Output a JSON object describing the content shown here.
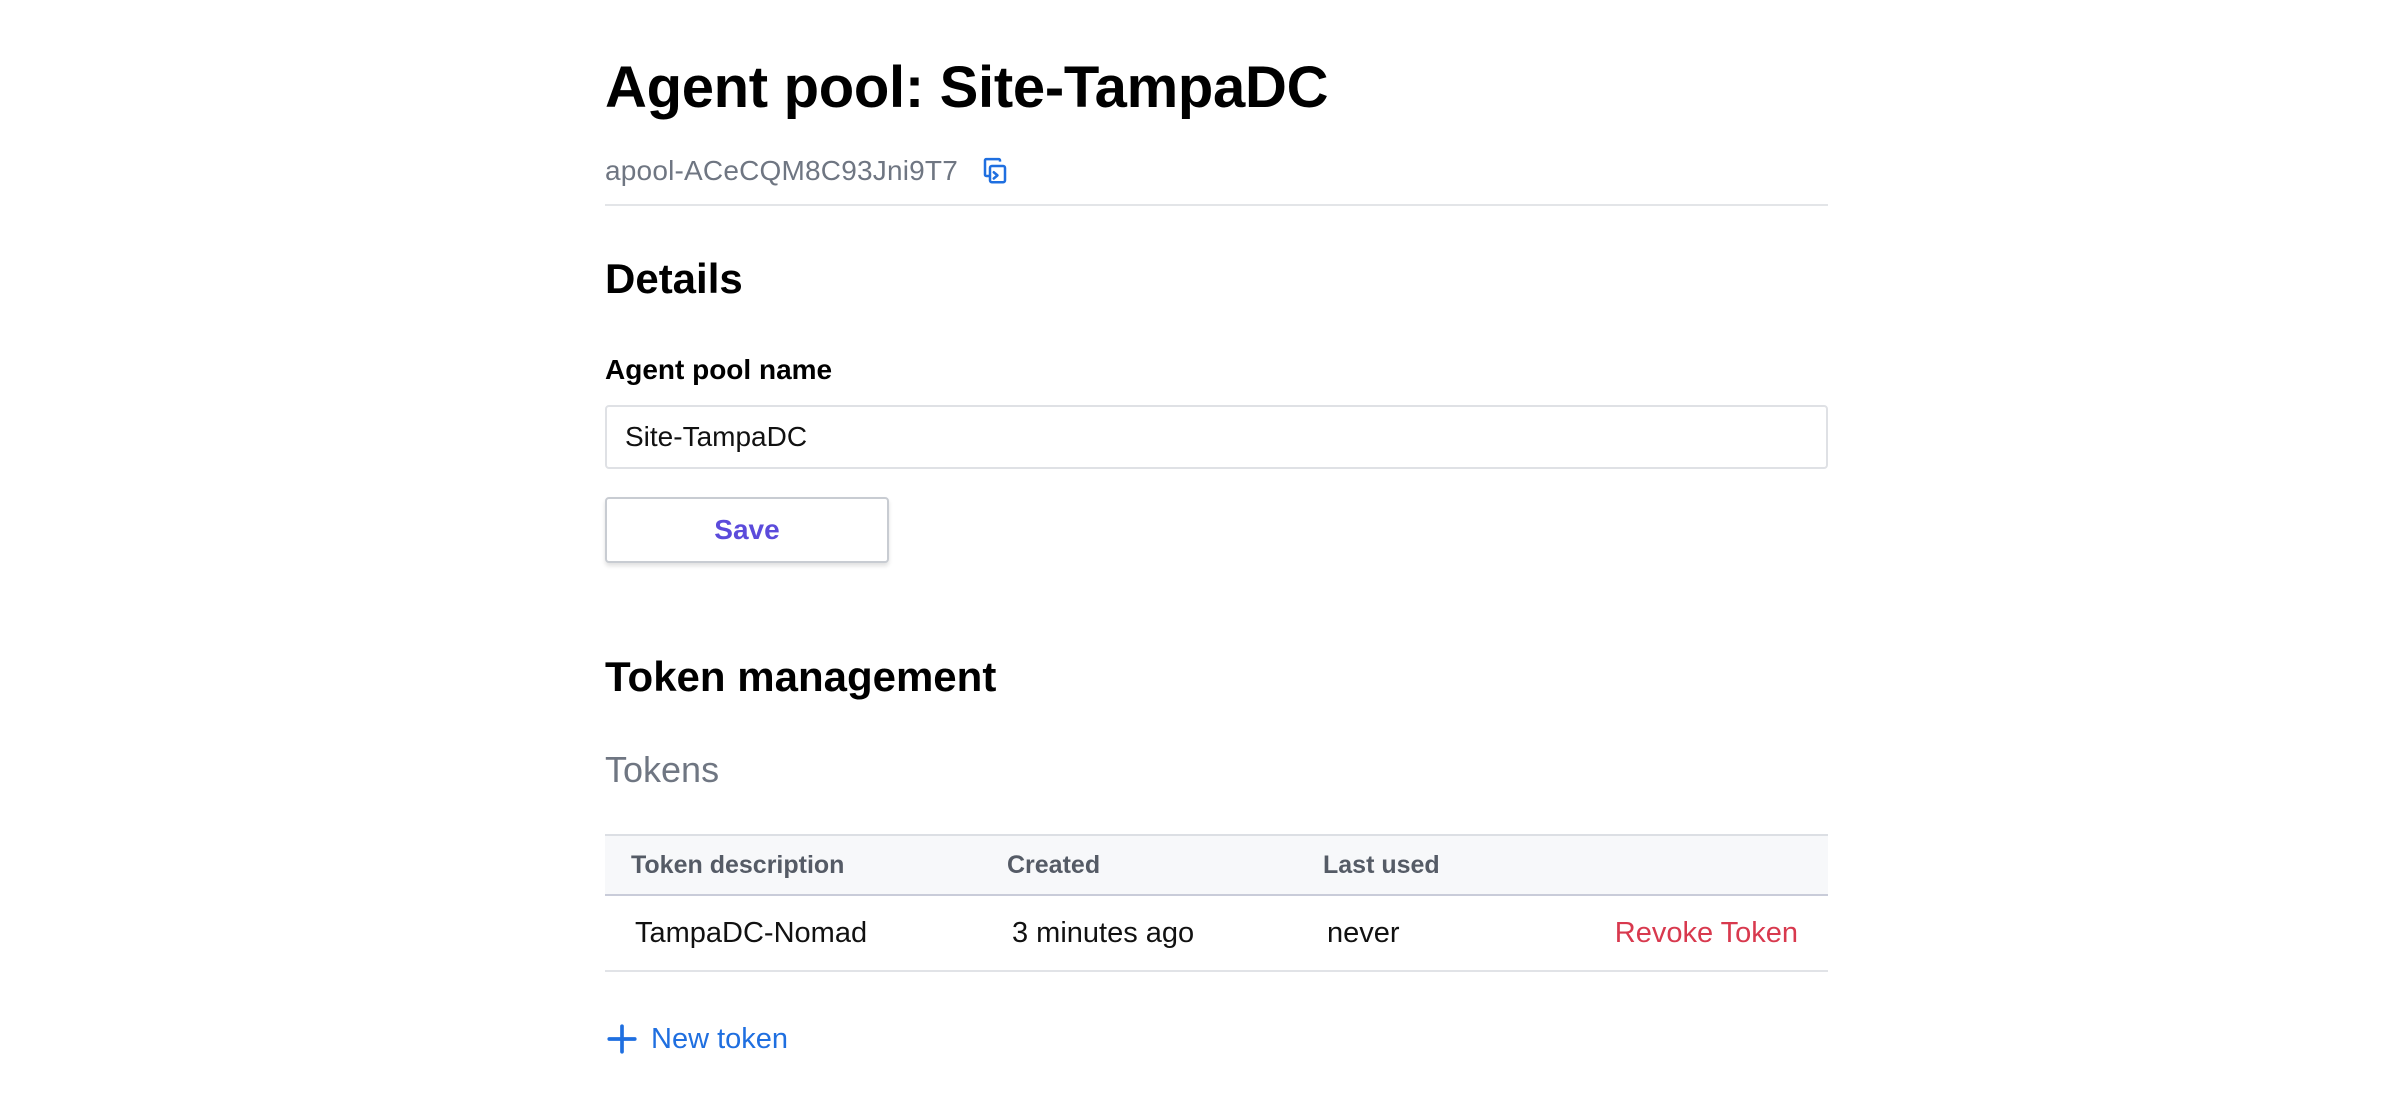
{
  "header": {
    "title": "Agent pool: Site-TampaDC",
    "pool_id": "apool-ACeCQM8C93Jni9T7",
    "copy_icon": "copy-icon"
  },
  "details": {
    "heading": "Details",
    "name_label": "Agent pool name",
    "name_value": "Site-TampaDC",
    "save_label": "Save"
  },
  "tokens": {
    "heading": "Token management",
    "subheading": "Tokens",
    "columns": [
      "Token description",
      "Created",
      "Last used"
    ],
    "rows": [
      {
        "description": "TampaDC-Nomad",
        "created": "3 minutes ago",
        "last_used": "never",
        "action": "Revoke Token"
      }
    ],
    "new_token_label": "New token",
    "new_token_icon": "plus-icon"
  },
  "colors": {
    "accent_purple": "#5b4bdb",
    "link_blue": "#1f6fe0",
    "danger_red": "#d8394e",
    "muted_text": "#6f7682"
  }
}
